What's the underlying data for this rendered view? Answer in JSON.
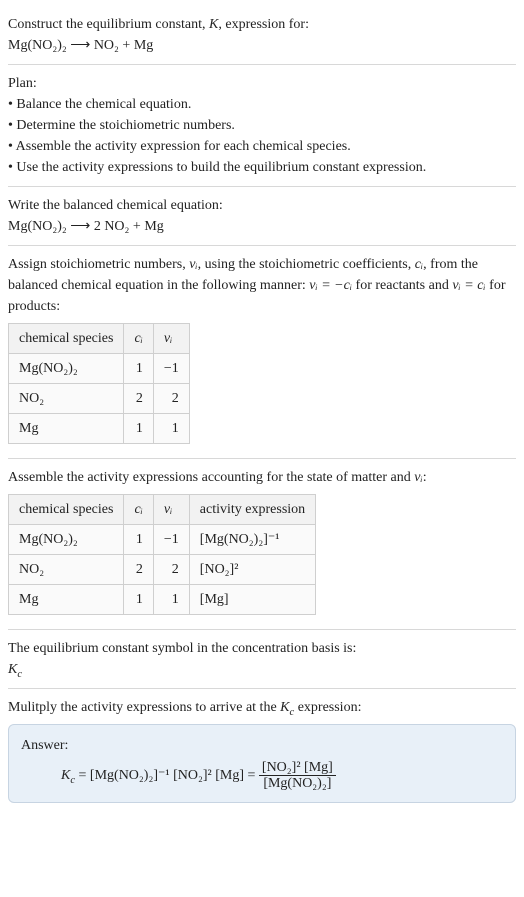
{
  "intro": {
    "line1_a": "Construct the equilibrium constant, ",
    "K": "K",
    "line1_b": ", expression for:",
    "equation": "Mg(NO₂)₂ ⟶ NO₂ + Mg"
  },
  "plan": {
    "heading": "Plan:",
    "items": [
      "• Balance the chemical equation.",
      "• Determine the stoichiometric numbers.",
      "• Assemble the activity expression for each chemical species.",
      "• Use the activity expressions to build the equilibrium constant expression."
    ]
  },
  "balanced": {
    "heading": "Write the balanced chemical equation:",
    "equation": "Mg(NO₂)₂ ⟶ 2 NO₂ + Mg"
  },
  "stoich": {
    "text_a": "Assign stoichiometric numbers, ",
    "ni": "νᵢ",
    "text_b": ", using the stoichiometric coefficients, ",
    "ci": "cᵢ",
    "text_c": ", from the balanced chemical equation in the following manner: ",
    "rel1": "νᵢ = −cᵢ",
    "text_d": " for reactants and ",
    "rel2": "νᵢ = cᵢ",
    "text_e": " for products:",
    "headers": [
      "chemical species",
      "cᵢ",
      "νᵢ"
    ],
    "rows": [
      {
        "species": "Mg(NO₂)₂",
        "c": "1",
        "v": "−1"
      },
      {
        "species": "NO₂",
        "c": "2",
        "v": "2"
      },
      {
        "species": "Mg",
        "c": "1",
        "v": "1"
      }
    ]
  },
  "activity": {
    "heading_a": "Assemble the activity expressions accounting for the state of matter and ",
    "ni": "νᵢ",
    "heading_b": ":",
    "headers": [
      "chemical species",
      "cᵢ",
      "νᵢ",
      "activity expression"
    ],
    "rows": [
      {
        "species": "Mg(NO₂)₂",
        "c": "1",
        "v": "−1",
        "expr": "[Mg(NO₂)₂]⁻¹"
      },
      {
        "species": "NO₂",
        "c": "2",
        "v": "2",
        "expr": "[NO₂]²"
      },
      {
        "species": "Mg",
        "c": "1",
        "v": "1",
        "expr": "[Mg]"
      }
    ]
  },
  "symbol": {
    "line": "The equilibrium constant symbol in the concentration basis is:",
    "kc": "K",
    "kc_sub": "c"
  },
  "multiply": {
    "line_a": "Mulitply the activity expressions to arrive at the ",
    "kc": "K",
    "kc_sub": "c",
    "line_b": " expression:"
  },
  "answer": {
    "label": "Answer:",
    "lhs_K": "K",
    "lhs_sub": "c",
    "eq": " = ",
    "term1": "[Mg(NO₂)₂]⁻¹",
    "term2": "[NO₂]²",
    "term3": "[Mg]",
    "eq2": " = ",
    "num": "[NO₂]² [Mg]",
    "den": "[Mg(NO₂)₂]"
  }
}
